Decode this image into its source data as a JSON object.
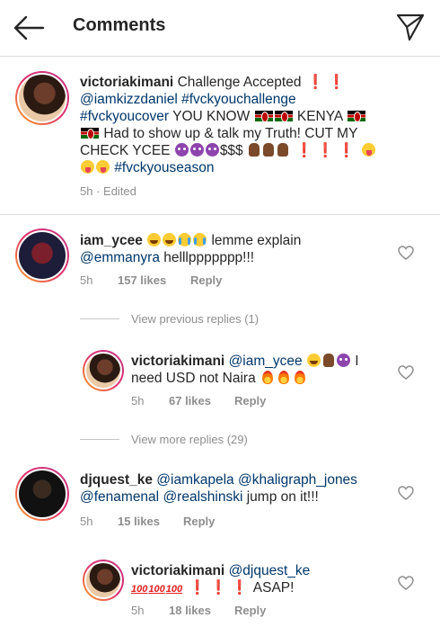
{
  "header": {
    "title": "Comments"
  },
  "caption": {
    "username": "victoriakimani",
    "text_1": "Challenge Accepted",
    "mention_1": "@iamkizzdaniel",
    "tag_1": "#fvckyouchallenge",
    "tag_2": "#fvckyoucover",
    "text_2": "YOU KNOW",
    "text_3": "KENYA",
    "text_4": "Had to show up & talk my Truth! CUT MY CHECK YCEE",
    "text_5": "$$$",
    "tag_3": "#fvckyouseason",
    "time": "5h",
    "edited": "Edited"
  },
  "comments": [
    {
      "username": "iam_ycee",
      "text_1": "lemme explain",
      "mention": "@emmanyra",
      "text_2": "helllppppppp!!!",
      "time": "5h",
      "likes": "157 likes",
      "reply": "Reply",
      "view_replies": "View previous replies (1)"
    },
    {
      "username": "victoriakimani",
      "mention": "@iam_ycee",
      "text_1": "I need USD not Naira",
      "time": "5h",
      "likes": "67 likes",
      "reply": "Reply",
      "view_replies": "View more replies (29)"
    },
    {
      "username": "djquest_ke",
      "mention_1": "@iamkapela",
      "mention_2": "@khaligraph_jones",
      "mention_3": "@fenamenal",
      "mention_4": "@realshinski",
      "text_1": "jump on it!!!",
      "time": "5h",
      "likes": "15 likes",
      "reply": "Reply"
    },
    {
      "username": "victoriakimani",
      "mention": "@djquest_ke",
      "hundred": "100",
      "text_1": "ASAP!",
      "time": "5h",
      "likes": "18 likes",
      "reply": "Reply"
    }
  ],
  "colors": {
    "link": "#00376b",
    "meta": "#8e8e8e",
    "text": "#262626",
    "divider": "#dbdbdb"
  },
  "icons": {
    "back": "arrow-left-icon",
    "share": "paper-plane-icon",
    "like": "heart-outline-icon"
  }
}
